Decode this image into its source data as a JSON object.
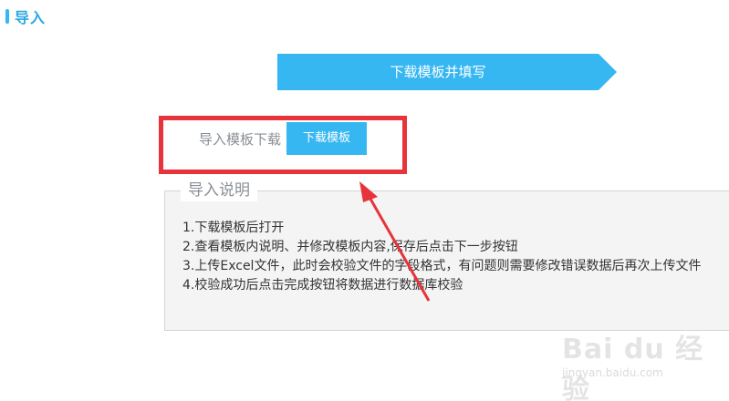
{
  "colors": {
    "accent": "#36b7f1",
    "title": "#2aa7e2",
    "annotation": "#e8333a"
  },
  "header": {
    "title": "导入"
  },
  "step": {
    "label": "下载模板并填写"
  },
  "download": {
    "label": "导入模板下载",
    "button_label": "下载模板"
  },
  "instructions": {
    "legend": "导入说明",
    "items": [
      "1.下载模板后打开",
      "2.查看模板内说明、并修改模板内容,保存后点击下一步按钮",
      "3.上传Excel文件，此时会校验文件的字段格式，有问题则需要修改错误数据后再次上传文件",
      "4.校验成功后点击完成按钮将数据进行数据库校验"
    ]
  },
  "watermark": {
    "main": "Bai du 经验",
    "sub": "jingyan.baidu.com"
  }
}
